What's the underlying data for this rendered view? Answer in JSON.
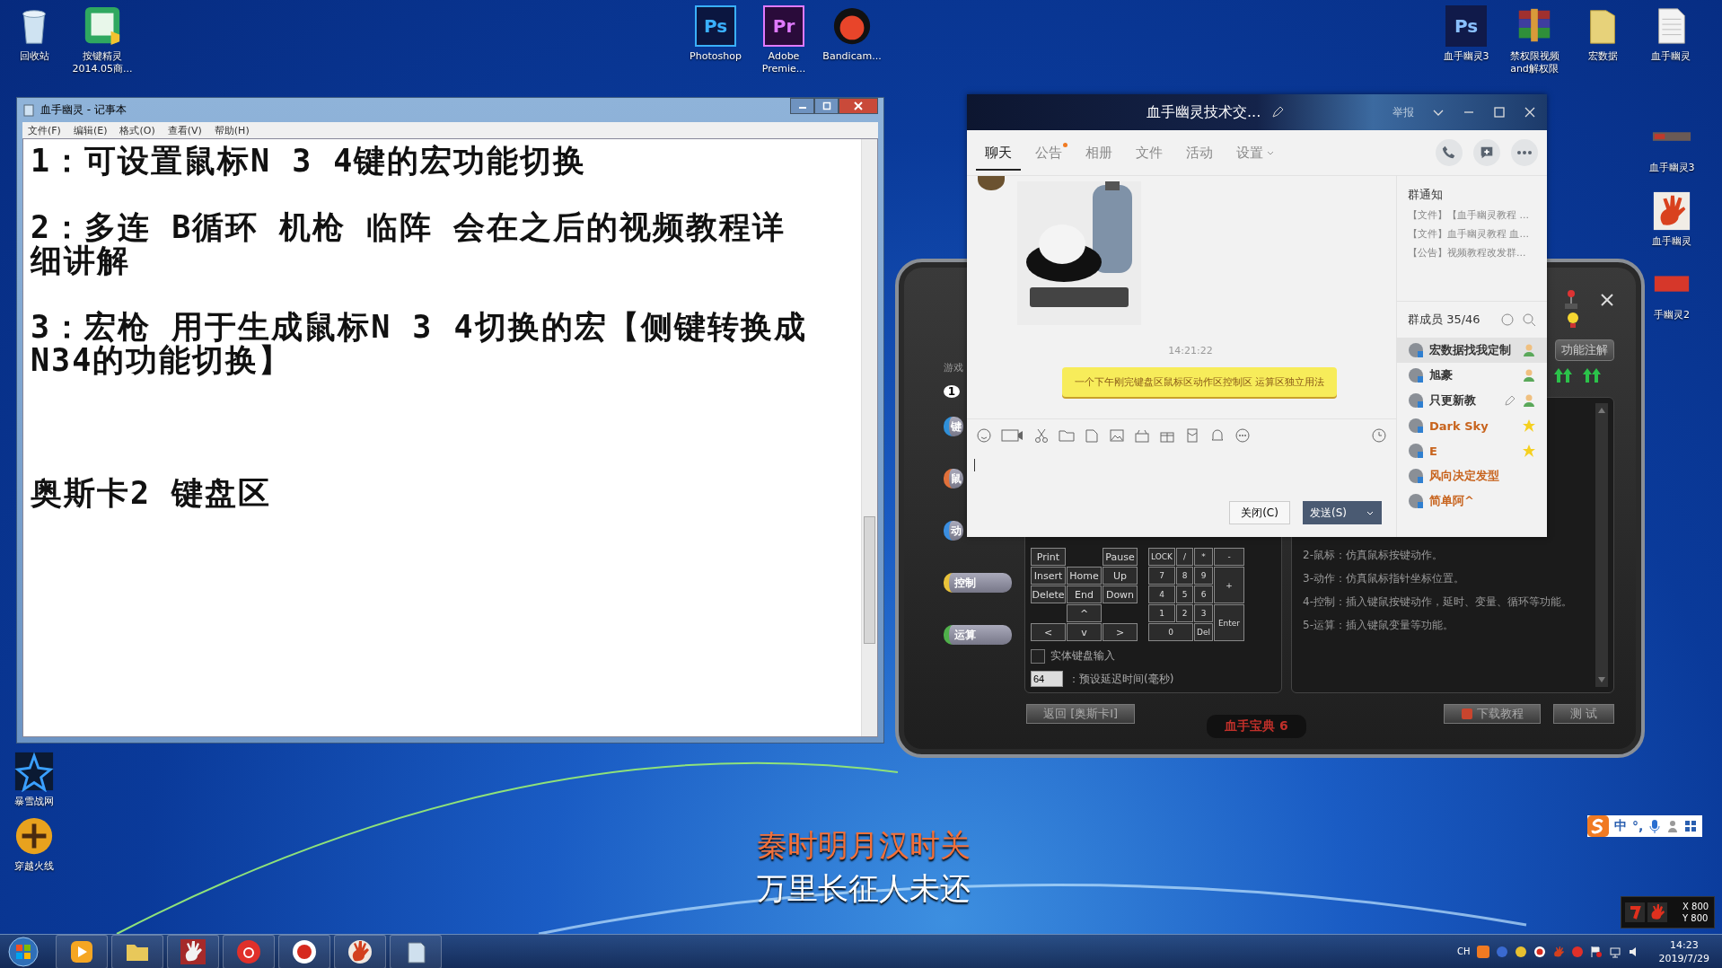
{
  "desktop": {
    "top_left_icons": [
      {
        "label": "回收站",
        "kind": "recycle"
      },
      {
        "label": "按键精灵\n2014.05商...",
        "kind": "green-app"
      }
    ],
    "top_center_icons": [
      {
        "label": "Photoshop",
        "kind": "ps",
        "icon_text": "Ps"
      },
      {
        "label": "Adobe\nPremie...",
        "kind": "pr",
        "icon_text": "Pr"
      },
      {
        "label": "Bandicam...",
        "kind": "record"
      }
    ],
    "top_right_icons": [
      {
        "label": "血手幽灵3",
        "kind": "psd",
        "icon_text": "Ps"
      },
      {
        "label": "禁权限视频\nand解权限",
        "kind": "archive"
      },
      {
        "label": "宏数据",
        "kind": "folder"
      },
      {
        "label": "血手幽灵",
        "kind": "textfile"
      }
    ],
    "right_icons": [
      {
        "label": "血手幽灵3",
        "kind": "banner"
      },
      {
        "label": "血手幽灵",
        "kind": "hand"
      },
      {
        "label": "手幽灵2",
        "kind": "redlabel"
      }
    ],
    "left_icons": [
      {
        "label": "暴雪战网",
        "kind": "star-app"
      },
      {
        "label": "穿越火线",
        "kind": "shooter-app"
      }
    ],
    "subtitle": [
      "秦时明月汉时关",
      "万里长征人未还"
    ]
  },
  "notepad": {
    "title": "血手幽灵 - 记事本",
    "menu": [
      "文件(F)",
      "编辑(E)",
      "格式(O)",
      "查看(V)",
      "帮助(H)"
    ],
    "paragraphs": [
      "1：可设置鼠标N 3 4键的宏功能切换",
      "2：多连 B循环 机枪 临阵 会在之后的视频教程详细讲解",
      "3：宏枪 用于生成鼠标N 3 4切换的宏【侧键转换成N34的功能切换】",
      "奥斯卡2 键盘区"
    ]
  },
  "macro_window": {
    "tab_label": "游戏",
    "step": "1",
    "notes_button": "功能注解",
    "sections": [
      {
        "label": "键",
        "color": "#2f8fd8"
      },
      {
        "label": "鼠",
        "color": "#e0703a"
      },
      {
        "label": "动",
        "color": "#3a8ee0"
      },
      {
        "label": "控制",
        "color": "#e8c23a"
      },
      {
        "label": "运算",
        "color": "#4fb04a"
      }
    ],
    "nav_keys": [
      {
        "kind": "key",
        "label": "Print"
      },
      {
        "kind": "gap"
      },
      {
        "kind": "key",
        "label": "Pause"
      },
      {
        "kind": "key",
        "label": "Insert"
      },
      {
        "kind": "key",
        "label": "Home"
      },
      {
        "kind": "key",
        "label": "Up"
      },
      {
        "kind": "key",
        "label": "Delete"
      },
      {
        "kind": "key",
        "label": "End"
      },
      {
        "kind": "key",
        "label": "Down"
      },
      {
        "kind": "gap"
      },
      {
        "kind": "key",
        "label": "^"
      },
      {
        "kind": "gap"
      },
      {
        "kind": "key",
        "label": "<"
      },
      {
        "kind": "key",
        "label": "v"
      },
      {
        "kind": "key",
        "label": ">"
      }
    ],
    "num_keys": [
      {
        "kind": "key",
        "label": "LOCK"
      },
      {
        "kind": "key",
        "label": "/"
      },
      {
        "kind": "key",
        "label": "*"
      },
      {
        "kind": "key",
        "label": "-"
      },
      {
        "kind": "key",
        "label": "7"
      },
      {
        "kind": "key",
        "label": "8"
      },
      {
        "kind": "key",
        "label": "9"
      },
      {
        "kind": "tall",
        "label": "+"
      },
      {
        "kind": "key",
        "label": "4"
      },
      {
        "kind": "key",
        "label": "5"
      },
      {
        "kind": "key",
        "label": "6"
      },
      {
        "kind": "key",
        "label": "1"
      },
      {
        "kind": "key",
        "label": "2"
      },
      {
        "kind": "key",
        "label": "3"
      },
      {
        "kind": "tall",
        "label": "Enter"
      },
      {
        "kind": "wide",
        "label": "0"
      },
      {
        "kind": "key",
        "label": "Del"
      }
    ],
    "physical_input": {
      "label": "实体键盘输入",
      "checked": false
    },
    "delay": {
      "value": "64",
      "label": "：预设延迟时间(毫秒)"
    },
    "descriptions": [
      "2-鼠标：仿真鼠标按键动作。",
      "3-动作：仿真鼠标指针坐标位置。",
      "4-控制：插入键鼠按键动作，延时、变量、循环等功能。",
      "5-运算：插入键鼠变量等功能。"
    ],
    "back_button": "返回 [奥斯卡I]",
    "download_button": "下载教程",
    "test_button": "测 试",
    "footer": "血手宝典 6"
  },
  "chat_window": {
    "title": "血手幽灵技术交...",
    "report": "举报",
    "tabs": [
      {
        "label": "聊天",
        "selected": true,
        "notification": false,
        "dropdown": false
      },
      {
        "label": "公告",
        "selected": false,
        "notification": true,
        "dropdown": false
      },
      {
        "label": "相册",
        "selected": false,
        "notification": false,
        "dropdown": false
      },
      {
        "label": "文件",
        "selected": false,
        "notification": false,
        "dropdown": false
      },
      {
        "label": "活动",
        "selected": false,
        "notification": false,
        "dropdown": false
      },
      {
        "label": "设置",
        "selected": false,
        "notification": false,
        "dropdown": true
      }
    ],
    "timestamp": "14:21:22",
    "bubble": "一个下午刚完键盘区鼠标区动作区控制区 运算区独立用法",
    "close_button": "关闭(C)",
    "send_button": "发送(S)",
    "notice_title": "群通知",
    "notices": [
      "【文件】【血手幽灵教程 ...",
      "【文件】血手幽灵教程 血...",
      "【公告】视频教程改发群..."
    ],
    "members_title": "群成员 35/46",
    "members": [
      {
        "name": "宏数据找我定制",
        "color": "#333333",
        "kind": "person",
        "selected": true,
        "edit": false
      },
      {
        "name": "旭豪",
        "color": "#333333",
        "kind": "person",
        "selected": false,
        "edit": false
      },
      {
        "name": "只更新教",
        "color": "#333333",
        "kind": "person",
        "selected": false,
        "edit": true
      },
      {
        "name": "Dark Sky",
        "color": "#c8641e",
        "kind": "star",
        "selected": false,
        "edit": false
      },
      {
        "name": "E",
        "color": "#c8641e",
        "kind": "star",
        "selected": false,
        "edit": false
      },
      {
        "name": "风向决定发型",
        "color": "#c8641e",
        "kind": "none",
        "selected": false,
        "edit": false
      },
      {
        "name": "简单阿^",
        "color": "#c8641e",
        "kind": "none",
        "selected": false,
        "edit": false
      }
    ]
  },
  "taskbar": {
    "items": [
      {
        "kind": "player"
      },
      {
        "kind": "folder"
      },
      {
        "kind": "hand"
      },
      {
        "kind": "music"
      },
      {
        "kind": "record"
      },
      {
        "kind": "hand-round"
      },
      {
        "kind": "notepad"
      }
    ],
    "language": "CH",
    "time": "14:23",
    "date": "2019/7/29",
    "ime": {
      "mode": "中",
      "punct": "°,"
    },
    "mouse_widget": {
      "x": "X 800",
      "y": "Y 800"
    }
  }
}
